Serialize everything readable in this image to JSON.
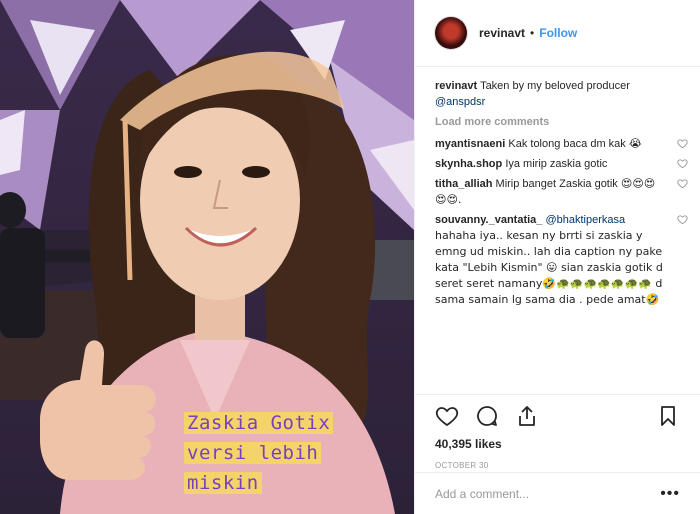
{
  "post": {
    "overlay_lines": [
      "Zaskia Gotix",
      "versi lebih",
      "miskin"
    ]
  },
  "header": {
    "username": "revinavt",
    "separator": "•",
    "follow_label": "Follow"
  },
  "caption": {
    "username": "revinavt",
    "text": "Taken by my beloved producer",
    "mention": "@anspdsr"
  },
  "load_more_label": "Load more comments",
  "comments": [
    {
      "user": "myantisnaeni",
      "text": "Kak tolong baca dm kak",
      "emoji": "😭"
    },
    {
      "user": "skynha.shop",
      "text": "Iya mirip zaskia gotic",
      "emoji": ""
    },
    {
      "user": "titha_alliah",
      "text": "Mirip banget Zaskia gotik",
      "emoji": "😍😍😍😍😍."
    },
    {
      "user": "souvanny._vantatia_",
      "mention": "@bhaktiperkasa",
      "text": "hahaha iya.. kesan ny brrti si zaskia y emng ud miskin.. lah dia caption ny pake kata \"Lebih Kismin\" 😛 sian zaskia gotik d seret seret namany🤣🐢🐢🐢🐢🐢🐢🐢 d sama samain lg sama dia . pede amat🤣"
    }
  ],
  "icons": {
    "like": "heart-icon",
    "comment": "comment-icon",
    "share": "share-icon",
    "save": "bookmark-icon"
  },
  "likes_label": "40,395 likes",
  "date_label": "OCTOBER 30",
  "add_comment_placeholder": "Add a comment...",
  "more_label": "•••",
  "colors": {
    "link": "#3897f0",
    "mention": "#003569",
    "overlay_bg": "#f3d36a",
    "overlay_text": "#7a3fbf"
  }
}
